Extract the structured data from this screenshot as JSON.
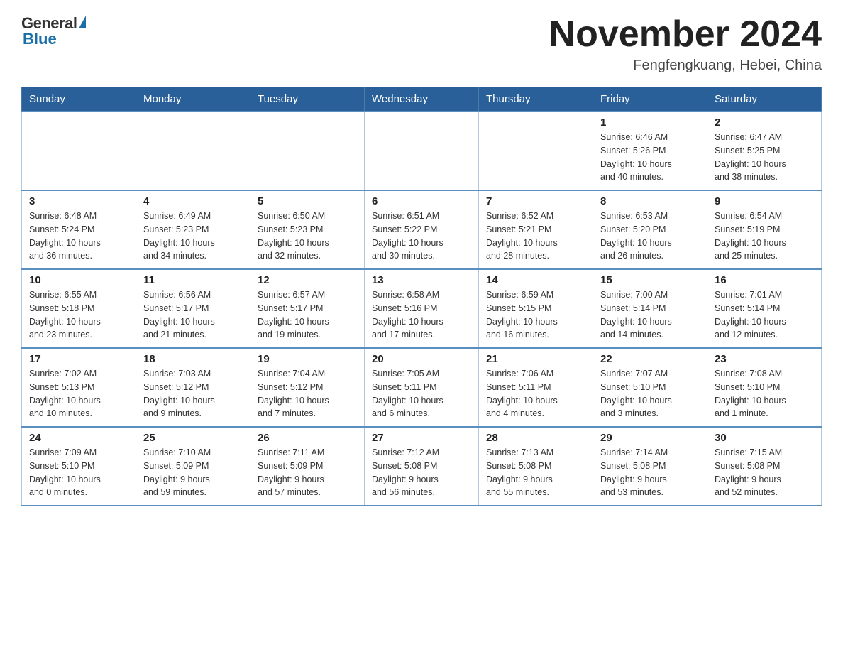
{
  "logo": {
    "general": "General",
    "blue": "Blue"
  },
  "header": {
    "title": "November 2024",
    "location": "Fengfengkuang, Hebei, China"
  },
  "weekdays": [
    "Sunday",
    "Monday",
    "Tuesday",
    "Wednesday",
    "Thursday",
    "Friday",
    "Saturday"
  ],
  "weeks": [
    [
      {
        "day": "",
        "info": ""
      },
      {
        "day": "",
        "info": ""
      },
      {
        "day": "",
        "info": ""
      },
      {
        "day": "",
        "info": ""
      },
      {
        "day": "",
        "info": ""
      },
      {
        "day": "1",
        "info": "Sunrise: 6:46 AM\nSunset: 5:26 PM\nDaylight: 10 hours\nand 40 minutes."
      },
      {
        "day": "2",
        "info": "Sunrise: 6:47 AM\nSunset: 5:25 PM\nDaylight: 10 hours\nand 38 minutes."
      }
    ],
    [
      {
        "day": "3",
        "info": "Sunrise: 6:48 AM\nSunset: 5:24 PM\nDaylight: 10 hours\nand 36 minutes."
      },
      {
        "day": "4",
        "info": "Sunrise: 6:49 AM\nSunset: 5:23 PM\nDaylight: 10 hours\nand 34 minutes."
      },
      {
        "day": "5",
        "info": "Sunrise: 6:50 AM\nSunset: 5:23 PM\nDaylight: 10 hours\nand 32 minutes."
      },
      {
        "day": "6",
        "info": "Sunrise: 6:51 AM\nSunset: 5:22 PM\nDaylight: 10 hours\nand 30 minutes."
      },
      {
        "day": "7",
        "info": "Sunrise: 6:52 AM\nSunset: 5:21 PM\nDaylight: 10 hours\nand 28 minutes."
      },
      {
        "day": "8",
        "info": "Sunrise: 6:53 AM\nSunset: 5:20 PM\nDaylight: 10 hours\nand 26 minutes."
      },
      {
        "day": "9",
        "info": "Sunrise: 6:54 AM\nSunset: 5:19 PM\nDaylight: 10 hours\nand 25 minutes."
      }
    ],
    [
      {
        "day": "10",
        "info": "Sunrise: 6:55 AM\nSunset: 5:18 PM\nDaylight: 10 hours\nand 23 minutes."
      },
      {
        "day": "11",
        "info": "Sunrise: 6:56 AM\nSunset: 5:17 PM\nDaylight: 10 hours\nand 21 minutes."
      },
      {
        "day": "12",
        "info": "Sunrise: 6:57 AM\nSunset: 5:17 PM\nDaylight: 10 hours\nand 19 minutes."
      },
      {
        "day": "13",
        "info": "Sunrise: 6:58 AM\nSunset: 5:16 PM\nDaylight: 10 hours\nand 17 minutes."
      },
      {
        "day": "14",
        "info": "Sunrise: 6:59 AM\nSunset: 5:15 PM\nDaylight: 10 hours\nand 16 minutes."
      },
      {
        "day": "15",
        "info": "Sunrise: 7:00 AM\nSunset: 5:14 PM\nDaylight: 10 hours\nand 14 minutes."
      },
      {
        "day": "16",
        "info": "Sunrise: 7:01 AM\nSunset: 5:14 PM\nDaylight: 10 hours\nand 12 minutes."
      }
    ],
    [
      {
        "day": "17",
        "info": "Sunrise: 7:02 AM\nSunset: 5:13 PM\nDaylight: 10 hours\nand 10 minutes."
      },
      {
        "day": "18",
        "info": "Sunrise: 7:03 AM\nSunset: 5:12 PM\nDaylight: 10 hours\nand 9 minutes."
      },
      {
        "day": "19",
        "info": "Sunrise: 7:04 AM\nSunset: 5:12 PM\nDaylight: 10 hours\nand 7 minutes."
      },
      {
        "day": "20",
        "info": "Sunrise: 7:05 AM\nSunset: 5:11 PM\nDaylight: 10 hours\nand 6 minutes."
      },
      {
        "day": "21",
        "info": "Sunrise: 7:06 AM\nSunset: 5:11 PM\nDaylight: 10 hours\nand 4 minutes."
      },
      {
        "day": "22",
        "info": "Sunrise: 7:07 AM\nSunset: 5:10 PM\nDaylight: 10 hours\nand 3 minutes."
      },
      {
        "day": "23",
        "info": "Sunrise: 7:08 AM\nSunset: 5:10 PM\nDaylight: 10 hours\nand 1 minute."
      }
    ],
    [
      {
        "day": "24",
        "info": "Sunrise: 7:09 AM\nSunset: 5:10 PM\nDaylight: 10 hours\nand 0 minutes."
      },
      {
        "day": "25",
        "info": "Sunrise: 7:10 AM\nSunset: 5:09 PM\nDaylight: 9 hours\nand 59 minutes."
      },
      {
        "day": "26",
        "info": "Sunrise: 7:11 AM\nSunset: 5:09 PM\nDaylight: 9 hours\nand 57 minutes."
      },
      {
        "day": "27",
        "info": "Sunrise: 7:12 AM\nSunset: 5:08 PM\nDaylight: 9 hours\nand 56 minutes."
      },
      {
        "day": "28",
        "info": "Sunrise: 7:13 AM\nSunset: 5:08 PM\nDaylight: 9 hours\nand 55 minutes."
      },
      {
        "day": "29",
        "info": "Sunrise: 7:14 AM\nSunset: 5:08 PM\nDaylight: 9 hours\nand 53 minutes."
      },
      {
        "day": "30",
        "info": "Sunrise: 7:15 AM\nSunset: 5:08 PM\nDaylight: 9 hours\nand 52 minutes."
      }
    ]
  ]
}
